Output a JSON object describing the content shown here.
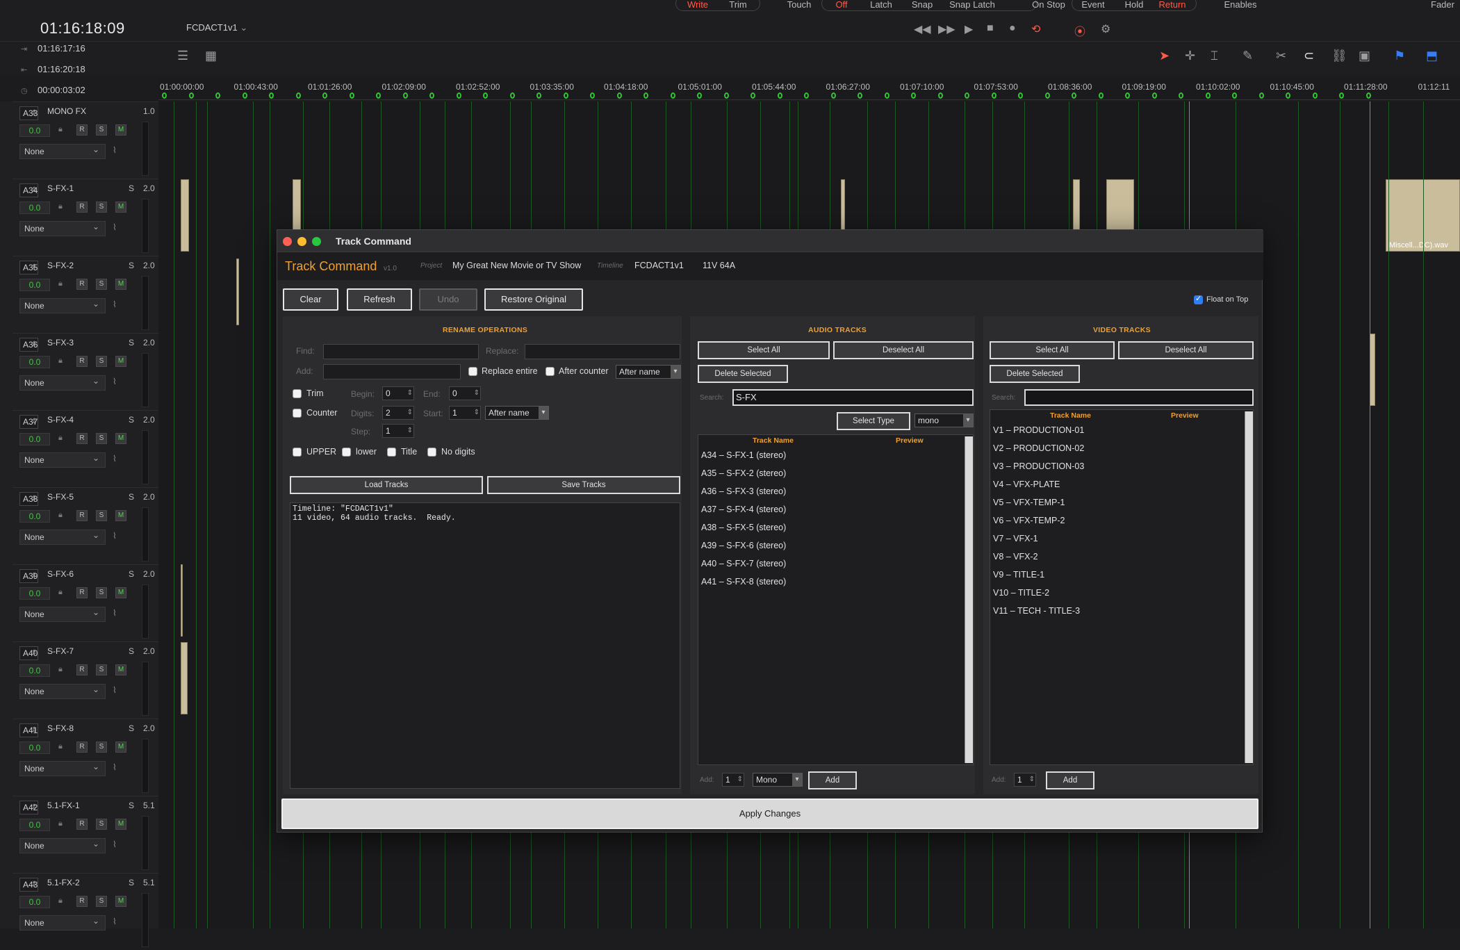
{
  "topbar": {
    "timecode": "01:16:18:09",
    "timeline_name": "FCDACT1v1",
    "write": "Write",
    "trim": "Trim",
    "touch": "Touch",
    "off": "Off",
    "latch": "Latch",
    "snap": "Snap",
    "snap_latch": "Snap Latch",
    "on_stop": "On Stop",
    "event": "Event",
    "hold": "Hold",
    "return": "Return",
    "enables": "Enables",
    "fader": "Fader"
  },
  "timecodes": {
    "in": "01:16:17:16",
    "out": "01:16:20:18",
    "duration": "00:00:03:02"
  },
  "ruler": [
    "01:00:00:00",
    "01:00:43:00",
    "01:01:26:00",
    "01:02:09:00",
    "01:02:52:00",
    "01:03:35:00",
    "01:04:18:00",
    "01:05:01:00",
    "01:05:44:00",
    "01:06:27:00",
    "01:07:10:00",
    "01:07:53:00",
    "01:08:36:00",
    "01:09:19:00",
    "01:10:02:00",
    "01:10:45:00",
    "01:11:28:00",
    "01:12:11"
  ],
  "tracks": [
    {
      "num": "A33",
      "name": "MONO FX",
      "s": "",
      "ch": "1.0",
      "vol": "0.0",
      "patch": "None"
    },
    {
      "num": "A34",
      "name": "S-FX-1",
      "s": "S",
      "ch": "2.0",
      "vol": "0.0",
      "patch": "None"
    },
    {
      "num": "A35",
      "name": "S-FX-2",
      "s": "S",
      "ch": "2.0",
      "vol": "0.0",
      "patch": "None"
    },
    {
      "num": "A36",
      "name": "S-FX-3",
      "s": "S",
      "ch": "2.0",
      "vol": "0.0",
      "patch": "None"
    },
    {
      "num": "A37",
      "name": "S-FX-4",
      "s": "S",
      "ch": "2.0",
      "vol": "0.0",
      "patch": "None"
    },
    {
      "num": "A38",
      "name": "S-FX-5",
      "s": "S",
      "ch": "2.0",
      "vol": "0.0",
      "patch": "None"
    },
    {
      "num": "A39",
      "name": "S-FX-6",
      "s": "S",
      "ch": "2.0",
      "vol": "0.0",
      "patch": "None"
    },
    {
      "num": "A40",
      "name": "S-FX-7",
      "s": "S",
      "ch": "2.0",
      "vol": "0.0",
      "patch": "None"
    },
    {
      "num": "A41",
      "name": "S-FX-8",
      "s": "S",
      "ch": "2.0",
      "vol": "0.0",
      "patch": "None"
    },
    {
      "num": "A42",
      "name": "5.1-FX-1",
      "s": "S",
      "ch": "5.1",
      "vol": "0.0",
      "patch": "None"
    },
    {
      "num": "A43",
      "name": "5.1-FX-2",
      "s": "S",
      "ch": "5.1",
      "vol": "0.0",
      "patch": "None"
    }
  ],
  "clip_label": "Miscell...DC).wav",
  "dialog": {
    "title": "Track Command",
    "brand": "Track Command",
    "version": "v1.0",
    "project_label": "Project",
    "project": "My Great New Movie or TV Show",
    "timeline_label": "Timeline",
    "timeline": "FCDACT1v1",
    "counts": "11V  64A",
    "buttons": {
      "clear": "Clear",
      "refresh": "Refresh",
      "undo": "Undo",
      "restore": "Restore Original",
      "apply": "Apply Changes"
    },
    "float_on_top": "Float on Top",
    "rename": {
      "title": "RENAME OPERATIONS",
      "find": "Find:",
      "replace": "Replace:",
      "add": "Add:",
      "replace_entire": "Replace entire",
      "after_counter": "After counter",
      "position": "After name",
      "trim": "Trim",
      "begin": "Begin:",
      "begin_val": "0",
      "end": "End:",
      "end_val": "0",
      "counter": "Counter",
      "digits": "Digits:",
      "digits_val": "2",
      "start": "Start:",
      "start_val": "1",
      "counter_pos": "After name",
      "step": "Step:",
      "step_val": "1",
      "upper": "UPPER",
      "lower": "lower",
      "title_case": "Title",
      "no_digits": "No digits",
      "load": "Load Tracks",
      "save": "Save Tracks",
      "log": "Timeline: \"FCDACT1v1\"\n11 video, 64 audio tracks.  Ready."
    },
    "audio": {
      "title": "AUDIO TRACKS",
      "select_all": "Select All",
      "deselect_all": "Deselect All",
      "delete_selected": "Delete Selected",
      "search_label": "Search:",
      "search_value": "S-FX",
      "select_type": "Select Type",
      "type_value": "mono",
      "col_name": "Track Name",
      "col_preview": "Preview",
      "items": [
        "A34 – S-FX-1  (stereo)",
        "A35 – S-FX-2  (stereo)",
        "A36 – S-FX-3  (stereo)",
        "A37 – S-FX-4  (stereo)",
        "A38 – S-FX-5  (stereo)",
        "A39 – S-FX-6  (stereo)",
        "A40 – S-FX-7  (stereo)",
        "A41 – S-FX-8  (stereo)"
      ],
      "add_label": "Add:",
      "add_count": "1",
      "add_type": "Mono",
      "add_btn": "Add"
    },
    "video": {
      "title": "VIDEO TRACKS",
      "select_all": "Select All",
      "deselect_all": "Deselect All",
      "delete_selected": "Delete Selected",
      "search_label": "Search:",
      "search_value": "",
      "col_name": "Track Name",
      "col_preview": "Preview",
      "items": [
        "V1 – PRODUCTION-01",
        "V2 – PRODUCTION-02",
        "V3 – PRODUCTION-03",
        "V4 – VFX-PLATE",
        "V5 – VFX-TEMP-1",
        "V6 – VFX-TEMP-2",
        "V7 – VFX-1",
        "V8 – VFX-2",
        "V9 – TITLE-1",
        "V10 – TITLE-2",
        "V11 – TECH - TITLE-3"
      ],
      "add_label": "Add:",
      "add_count": "1",
      "add_btn": "Add"
    }
  },
  "colors": {
    "accent": "#f0a030",
    "meter_green": "#43c543",
    "return_red": "#ff5a4a"
  }
}
